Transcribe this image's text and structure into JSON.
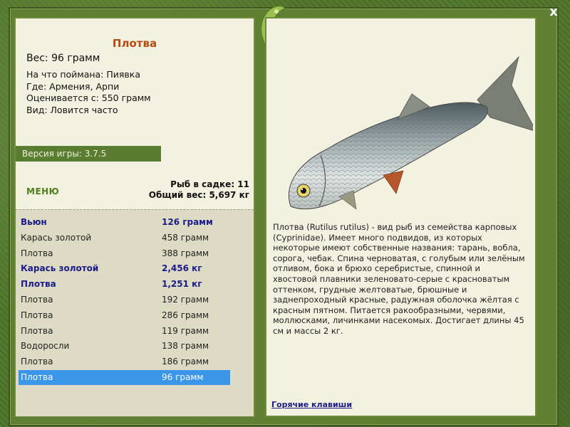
{
  "window": {
    "close_label": "x"
  },
  "fish": {
    "name": "Плотва",
    "weight": "Вес: 96 грамм",
    "caught_on": "На что поймана: Пиявка",
    "where": "Где: Армения, Арпи",
    "valued_from": "Оценивается с: 550 грамм",
    "view": "Вид: Ловится часто"
  },
  "version": "Версия игры: 3.7.5",
  "menu_label": "МЕНЮ",
  "summary": {
    "fish_in_cage": "Рыб в садке: 11",
    "total_weight": "Общий вес: 5,697 кг"
  },
  "catch_list": [
    {
      "name": "Вьюн",
      "weight": "126 грамм",
      "style": "bold"
    },
    {
      "name": "Карась золотой",
      "weight": "458 грамм",
      "style": "normal"
    },
    {
      "name": "Плотва",
      "weight": "388 грамм",
      "style": "normal"
    },
    {
      "name": "Карась золотой",
      "weight": "2,456 кг",
      "style": "bold"
    },
    {
      "name": "Плотва",
      "weight": "1,251 кг",
      "style": "bold"
    },
    {
      "name": "Плотва",
      "weight": "192 грамм",
      "style": "normal"
    },
    {
      "name": "Плотва",
      "weight": "286 грамм",
      "style": "normal"
    },
    {
      "name": "Плотва",
      "weight": "119 грамм",
      "style": "normal"
    },
    {
      "name": "Водоросли",
      "weight": "138 грамм",
      "style": "normal"
    },
    {
      "name": "Плотва",
      "weight": "186 грамм",
      "style": "normal"
    },
    {
      "name": "Плотва",
      "weight": "96 грамм",
      "style": "selected"
    }
  ],
  "description": "Плотва (Rutilus rutilus) - вид рыб из семейства карповых (Cyprinidae). Имеет много подвидов, из которых некоторые имеют собственные названия: тарань, вобла, сорога, чебак. Спина черноватая, с голубым или зелёным отливом, бока и брюхо серебристые, спинной и хвостовой плавники зеленовато-серые с красноватым оттенком, грудные желтоватые, брюшные и заднепроходный красные, радужная оболочка жёлтая с красным пятном. Питается ракообразными, червями, моллюсками, личинками насекомых. Достигает длины 45 см и массы 2 кг.",
  "hotkeys_label": "Горячие клавиши",
  "colors": {
    "title": "#b34b12",
    "list_bold": "#1b1b8a",
    "selected": "#3b95e8",
    "panel_bg": "#f3f1df",
    "frame": "#5f7f33"
  }
}
